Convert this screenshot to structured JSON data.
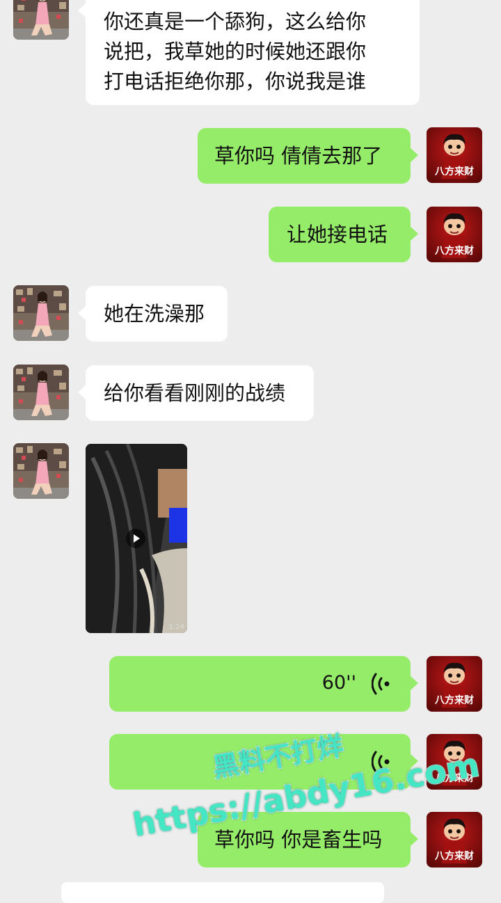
{
  "messages": {
    "m1": {
      "lines": [
        "你还真是一个舔狗，这么给你",
        "说把，我草她的时候她还跟你",
        "打电话拒绝你那，你说我是谁"
      ]
    },
    "m2": {
      "text": "草你吗 倩倩去那了"
    },
    "m3": {
      "text": "让她接电话"
    },
    "m4": {
      "text": "她在洗澡那"
    },
    "m5": {
      "text": "给你看看刚刚的战绩"
    },
    "m6": {
      "video_duration": "1:24"
    },
    "m7": {
      "duration": "60''"
    },
    "m8": {
      "duration": ""
    },
    "m9": {
      "text": "草你吗 你是畜生吗"
    }
  },
  "avatars": {
    "friend": "photo-avatar",
    "self": "cartoon-fortune-avatar",
    "self_caption": "八方来财"
  },
  "watermark": {
    "line1": "黑料不打烊",
    "line2": "https://abdy16.com"
  },
  "colors": {
    "background": "#ededed",
    "incoming_bubble": "#ffffff",
    "outgoing_bubble": "#95ec69",
    "watermark": "#44e6c4"
  }
}
